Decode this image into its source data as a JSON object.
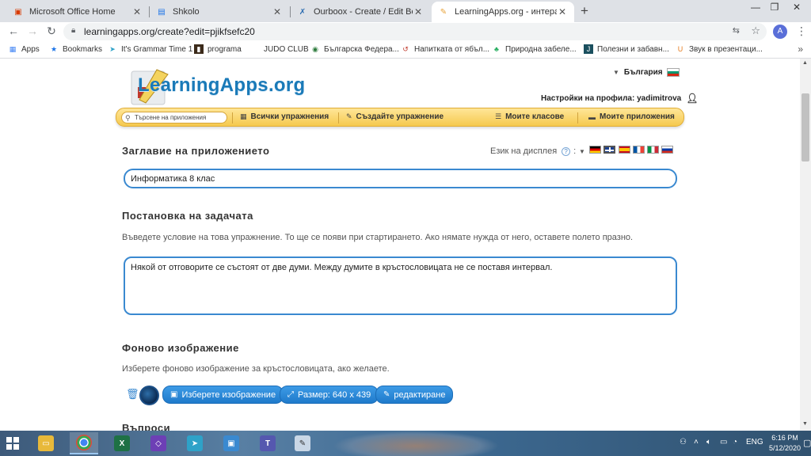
{
  "browser": {
    "tabs": [
      {
        "title": "Microsoft Office Home",
        "icon": "office-icon",
        "color": "#d83b01"
      },
      {
        "title": "Shkolo",
        "icon": "shkolo-icon",
        "color": "#1a73e8"
      },
      {
        "title": "Ourboox - Create / Edit Book",
        "icon": "ourboox-icon",
        "color": "#2b6cb0"
      },
      {
        "title": "LearningApps.org - интерактивн",
        "icon": "learningapps-icon",
        "color": "#e8a33a"
      }
    ],
    "new_tab_glyph": "+",
    "window_controls": {
      "minimize": "—",
      "restore": "❐",
      "close": "✕"
    },
    "url": "learningapps.org/create?edit=pjikfsefc20",
    "profile_initial": "A",
    "bookmarks": [
      {
        "label": "Apps",
        "icon": "apps-grid-icon"
      },
      {
        "label": "Bookmarks",
        "icon": "star-icon"
      },
      {
        "label": "It's Grammar Time 1",
        "icon": "send-icon"
      },
      {
        "label": "programa",
        "icon": "film-icon"
      },
      {
        "label": "JUDO CLUB",
        "icon": "blank-icon"
      },
      {
        "label": "Българска Федера...",
        "icon": "federation-icon"
      },
      {
        "label": "Напитката от ябъл...",
        "icon": "swirl-icon"
      },
      {
        "label": "Природна забеле...",
        "icon": "leaf-icon"
      },
      {
        "label": "Полезни и забавн...",
        "icon": "j-icon"
      },
      {
        "label": "Звук в презентаци...",
        "icon": "u-icon"
      }
    ],
    "bookmarks_overflow": "»"
  },
  "site": {
    "logo": "LearningApps.org",
    "country": "България",
    "profile_link": "Настройки на профила: yadimitrova",
    "search_placeholder": "Търсене на приложения",
    "nav": [
      {
        "label": "Всички упражнения",
        "icon": "grid-icon"
      },
      {
        "label": "Създайте упражнение",
        "icon": "pencil-icon"
      },
      {
        "label": "Моите класове",
        "icon": "list-icon"
      },
      {
        "label": "Моите приложения",
        "icon": "folder-icon"
      }
    ]
  },
  "form": {
    "app_title_heading": "Заглавие на приложението",
    "display_language_label": "Език на дисплея",
    "display_language_colon": ":",
    "help_glyph": "?",
    "language_flags": [
      "de",
      "en",
      "es",
      "fr",
      "it",
      "ru"
    ],
    "app_title_value": "Информатика 8 клас",
    "task_heading": "Постановка на задачата",
    "task_description": "Въведете условие на това упражнение. То ще се появи при стартирането. Ако нямате нужда от него, оставете полето празно.",
    "task_value": "Някой от отговорите се състоят от две думи. Между думите в кръстословицата не се поставя интервал.",
    "bg_heading": "Фоново изображение",
    "bg_description": "Изберете фоново изображение за кръстословицата, ако желаете.",
    "choose_image_button": "Изберете изображение",
    "size_button": "Размер: 640 x 439",
    "edit_button": "редактиране",
    "questions_heading": "Въпроси"
  },
  "taskbar": {
    "apps": [
      {
        "name": "file-explorer-icon",
        "color": "#e8b93a",
        "glyph": "▭"
      },
      {
        "name": "chrome-icon",
        "color": "#34a853",
        "glyph": "◉"
      },
      {
        "name": "excel-icon",
        "color": "#1e7145",
        "glyph": "X"
      },
      {
        "name": "visual-studio-icon",
        "color": "#6d3fb5",
        "glyph": "◇"
      },
      {
        "name": "paper-plane-icon",
        "color": "#2ea2c8",
        "glyph": "➤"
      },
      {
        "name": "cube-app-icon",
        "color": "#3a89d0",
        "glyph": "▣"
      },
      {
        "name": "teams-icon",
        "color": "#5558af",
        "glyph": "T"
      },
      {
        "name": "paint-icon",
        "color": "#c9d7e6",
        "glyph": "✎"
      }
    ],
    "language": "ENG",
    "time": "6:16 PM",
    "date": "5/12/2020"
  }
}
